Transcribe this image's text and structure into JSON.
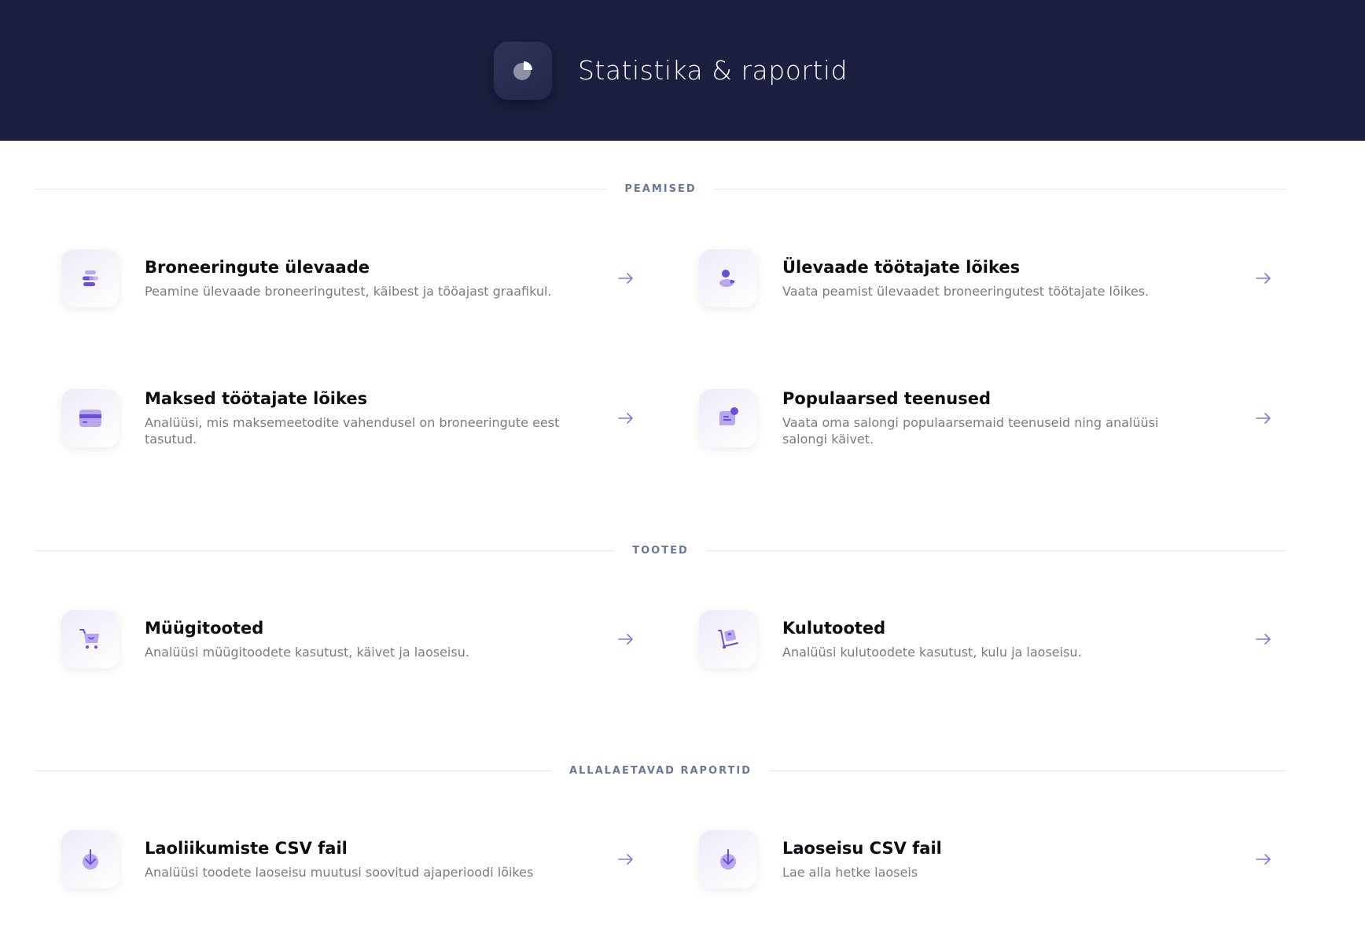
{
  "header": {
    "title": "Statistika & raportid",
    "icon": "pie-chart-icon"
  },
  "colors": {
    "header_bg": "#1c1f3f",
    "accent": "#6b4fd8",
    "accent_light": "#b7a6f0",
    "section_label": "#6a7899"
  },
  "sections": [
    {
      "label": "PEAMISED",
      "items": [
        {
          "title": "Broneeringute ülevaade",
          "desc": "Peamine ülevaade broneeringutest, käibest ja tööajast graafikul.",
          "icon": "bars-chart-icon"
        },
        {
          "title": "Ülevaade töötajate lõikes",
          "desc": "Vaata peamist ülevaadet broneeringutest töötajate lõikes.",
          "icon": "user-chart-icon"
        },
        {
          "title": "Maksed töötajate lõikes",
          "desc": "Analüüsi, mis maksemeetodite vahendusel on broneeringute eest tasutud.",
          "icon": "credit-card-icon"
        },
        {
          "title": "Populaarsed teenused",
          "desc": "Vaata oma salongi populaarsemaid teenuseid ning analüüsi salongi käivet.",
          "icon": "chat-badge-icon"
        }
      ]
    },
    {
      "label": "TOOTED",
      "items": [
        {
          "title": "Müügitooted",
          "desc": "Analüüsi müügitoodete kasutust, käivet ja laoseisu.",
          "icon": "shopping-cart-icon"
        },
        {
          "title": "Kulutooted",
          "desc": "Analüüsi kulutoodete kasutust, kulu ja laoseisu.",
          "icon": "hand-truck-icon"
        }
      ]
    },
    {
      "label": "ALLALAETAVAD RAPORTID",
      "items": [
        {
          "title": "Laoliikumiste CSV fail",
          "desc": "Analüüsi toodete laoseisu muutusi soovitud ajaperioodi lõikes",
          "icon": "download-icon"
        },
        {
          "title": "Laoseisu CSV fail",
          "desc": "Lae alla hetke laoseis",
          "icon": "download-icon"
        }
      ]
    }
  ]
}
